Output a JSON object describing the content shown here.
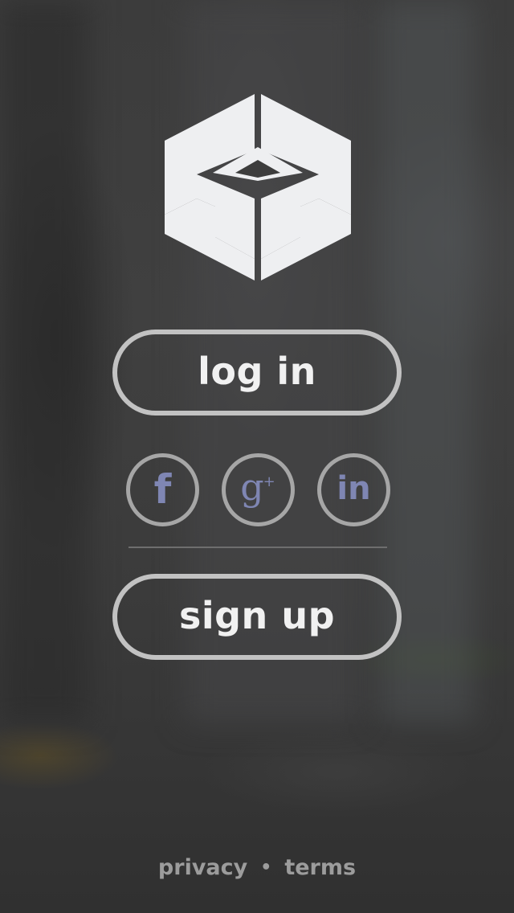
{
  "background": {
    "description_color": "#3a3a3a"
  },
  "logo": {
    "icon": "hexagon-cube-logo",
    "color": "#eeeff1"
  },
  "buttons": {
    "login_label": "log in",
    "signup_label": "sign up",
    "border_color": "#c2c2c2",
    "text_color": "#f1f1f1"
  },
  "social": {
    "accent_color": "#7f86b3",
    "items": [
      {
        "icon": "facebook-icon",
        "glyph": "f"
      },
      {
        "icon": "google-plus-icon",
        "glyph": "g",
        "super": "+"
      },
      {
        "icon": "linkedin-icon",
        "glyph": "in"
      }
    ]
  },
  "footer": {
    "privacy_label": "privacy",
    "separator": "•",
    "terms_label": "terms"
  }
}
